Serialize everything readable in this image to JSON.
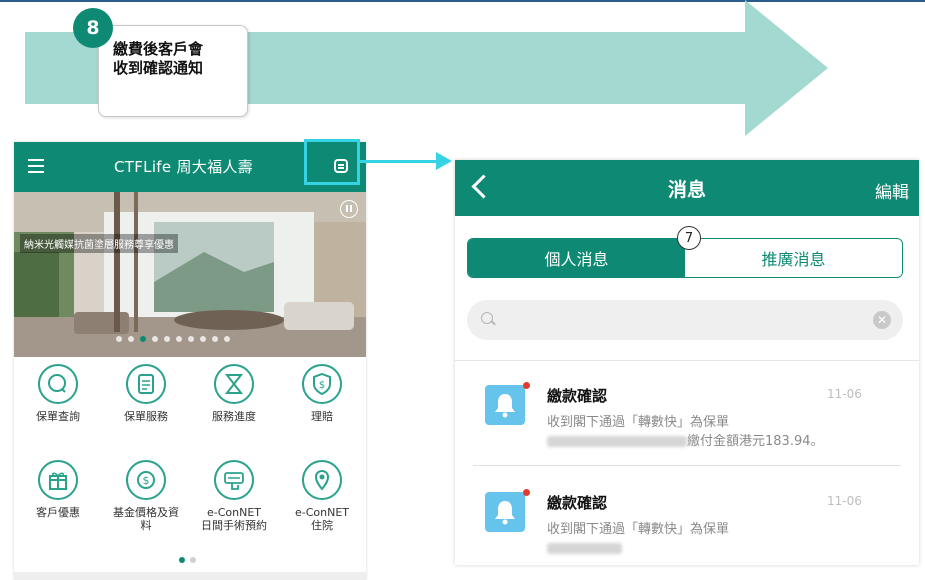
{
  "step": {
    "number": "8",
    "text": "繳費後客戶會\n收到確認通知"
  },
  "colors": {
    "brand_green": "#0e8a74",
    "highlight_cyan": "#35d3e4",
    "arrow_fill": "#a3d9d0",
    "bell_blue": "#66c3ec",
    "unread_red": "#e3392f"
  },
  "home": {
    "logo": "CTFLife 周大福人壽",
    "menu_icon": "menu-icon",
    "message_icon": "message-icon",
    "banner_caption": "納米光觸媒抗菌塗層服務尊享優惠",
    "banner_page_current": 3,
    "banner_page_total": 10,
    "services": [
      {
        "label": "保單查詢",
        "icon": "search-icon"
      },
      {
        "label": "保單服務",
        "icon": "document-icon"
      },
      {
        "label": "服務進度",
        "icon": "hourglass-icon"
      },
      {
        "label": "理賠",
        "icon": "shield-dollar-icon"
      },
      {
        "label": "客戶優惠",
        "icon": "gift-icon"
      },
      {
        "label": "基金價格及資\n料",
        "icon": "dollar-icon"
      },
      {
        "label": "e-ConNET\n日間手術預約",
        "icon": "booking-icon"
      },
      {
        "label": "e-ConNET\n住院",
        "icon": "location-icon"
      }
    ],
    "grid_page_current": 1,
    "grid_page_total": 2
  },
  "messages": {
    "title": "消息",
    "edit": "編輯",
    "back_icon": "back-icon",
    "tabs": [
      "個人消息",
      "推廣消息"
    ],
    "active_tab": 0,
    "tab_badge": "7",
    "search_placeholder": "",
    "items": [
      {
        "title": "繳款確認",
        "date": "11-06",
        "line1": "收到閣下通過「轉數快」為保單",
        "line2": "繳付金額港元183.94。"
      },
      {
        "title": "繳款確認",
        "date": "11-06",
        "line1": "收到閣下通過「轉數快」為保單",
        "line2": ""
      }
    ]
  }
}
